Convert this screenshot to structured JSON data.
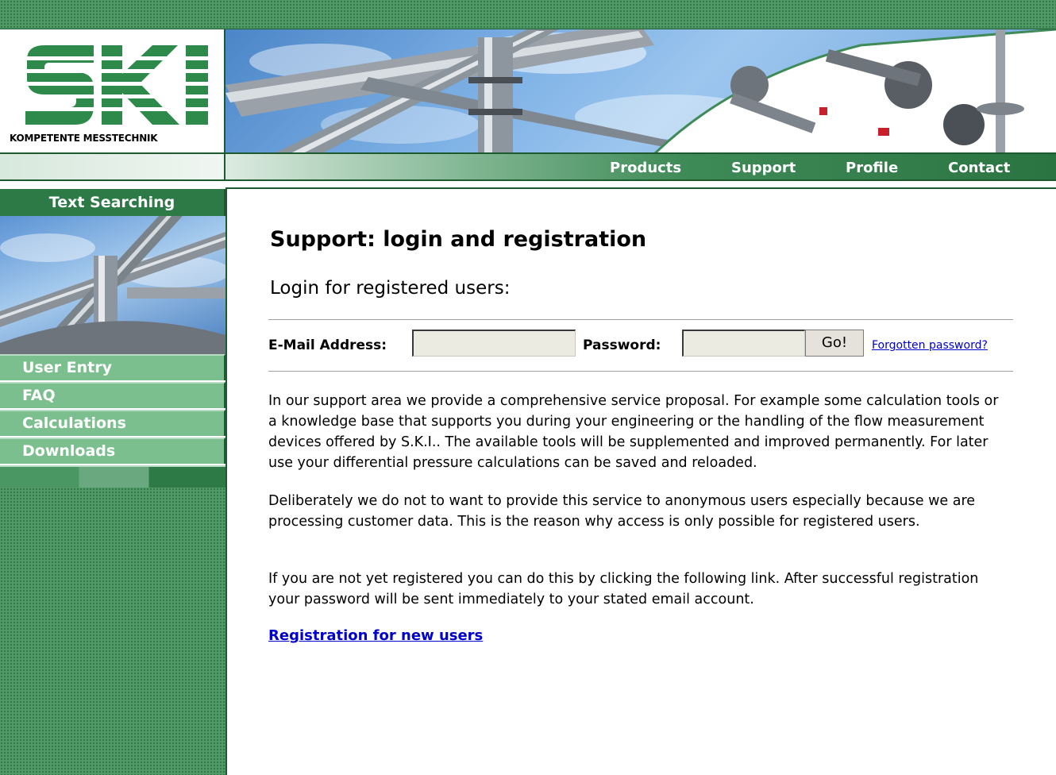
{
  "header": {
    "logo_tagline": "KOMPETENTE MESSTECHNIK"
  },
  "nav": {
    "items": [
      {
        "label": "Products"
      },
      {
        "label": "Support"
      },
      {
        "label": "Profile"
      },
      {
        "label": "Contact"
      }
    ]
  },
  "sidebar": {
    "title": "Text Searching",
    "items": [
      {
        "label": "User Entry"
      },
      {
        "label": "FAQ"
      },
      {
        "label": "Calculations"
      },
      {
        "label": "Downloads"
      }
    ]
  },
  "main": {
    "title": "Support: login and registration",
    "subtitle": "Login for registered users:",
    "login": {
      "email_label": "E-Mail Address:",
      "email_value": "",
      "password_label": "Password:",
      "password_value": "",
      "go_label": "Go!",
      "forgot_label": "Forgotten password?"
    },
    "paragraphs": [
      "In our support area we provide a comprehensive service proposal. For example some calculation tools or a knowledge base that supports you during your engineering or the handling of the flow measurement devices offered by S.K.I.. The available tools will be supplemented and improved permanently. For later use your differential pressure calculations can be saved and reloaded.",
      "Deliberately we do not to want to provide this service to anonymous users especially because we are processing customer data. This is the reason why access is only possible for registered users.",
      "If you are not yet registered you can do this by clicking the following link. After successful registration your password will be sent immediately to your stated email account."
    ],
    "registration_link": "Registration for new users"
  },
  "colors": {
    "brand_green": "#2d7a47",
    "light_green": "#7bbf8e",
    "link_blue": "#0000cc"
  }
}
